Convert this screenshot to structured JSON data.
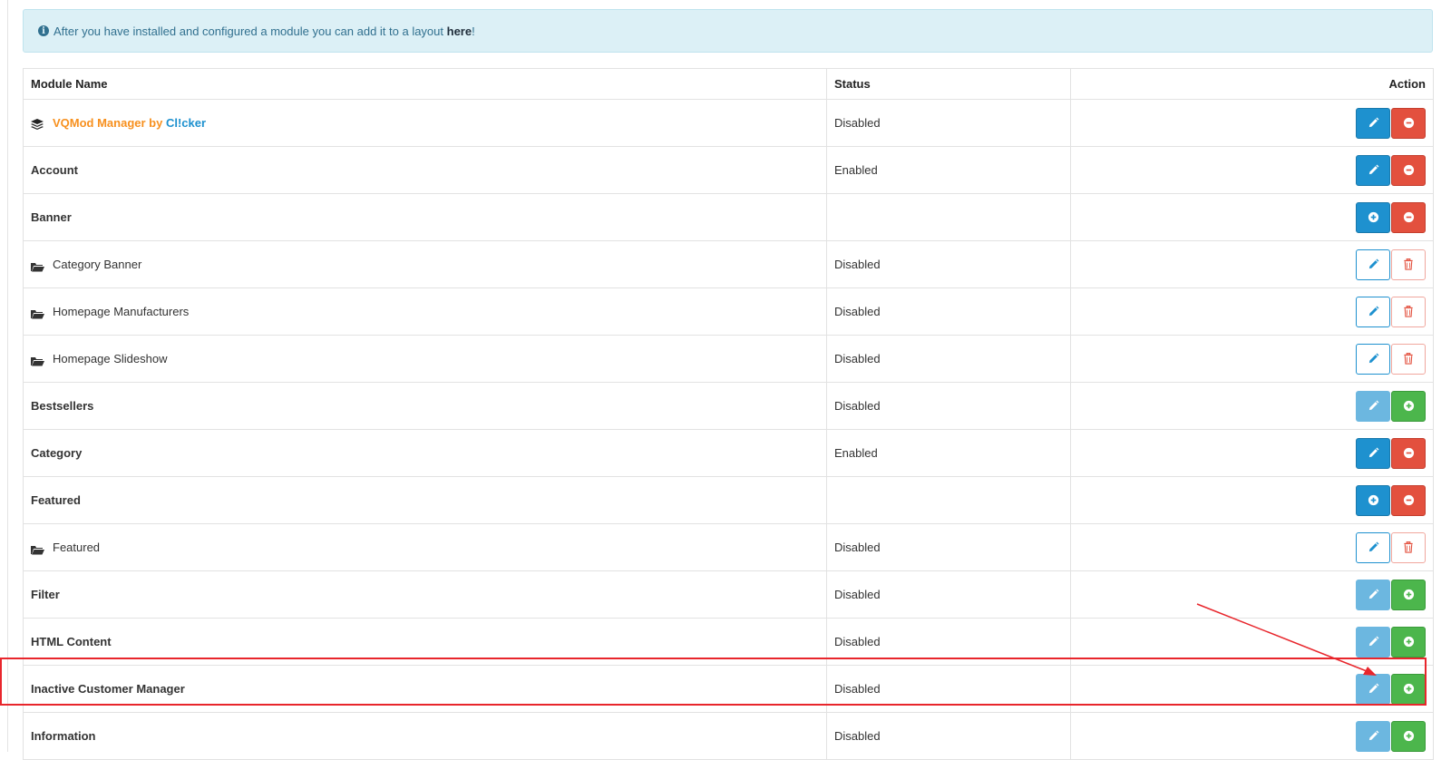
{
  "alert": {
    "text_before": "After you have installed and configured a module you can add it to a layout ",
    "link": "here",
    "text_after": "!"
  },
  "table": {
    "headers": {
      "name": "Module Name",
      "status": "Status",
      "action": "Action"
    },
    "rows": [
      {
        "name": "",
        "status": "Disabled",
        "type": "vqmod",
        "actions": [
          "edit",
          "uninstall"
        ]
      },
      {
        "name": "Account",
        "status": "Enabled",
        "type": "module",
        "actions": [
          "edit",
          "uninstall"
        ]
      },
      {
        "name": "Banner",
        "status": "",
        "type": "module",
        "actions": [
          "add",
          "uninstall"
        ]
      },
      {
        "name": "Category Banner",
        "status": "Disabled",
        "type": "child",
        "actions": [
          "edit-outline",
          "delete-outline"
        ]
      },
      {
        "name": "Homepage Manufacturers",
        "status": "Disabled",
        "type": "child",
        "actions": [
          "edit-outline",
          "delete-outline"
        ]
      },
      {
        "name": "Homepage Slideshow",
        "status": "Disabled",
        "type": "child",
        "actions": [
          "edit-outline",
          "delete-outline"
        ]
      },
      {
        "name": "Bestsellers",
        "status": "Disabled",
        "type": "module",
        "actions": [
          "edit-disabled",
          "install"
        ]
      },
      {
        "name": "Category",
        "status": "Enabled",
        "type": "module",
        "actions": [
          "edit",
          "uninstall"
        ]
      },
      {
        "name": "Featured",
        "status": "",
        "type": "module",
        "actions": [
          "add",
          "uninstall"
        ]
      },
      {
        "name": "Featured",
        "status": "Disabled",
        "type": "child",
        "actions": [
          "edit-outline",
          "delete-outline"
        ]
      },
      {
        "name": "Filter",
        "status": "Disabled",
        "type": "module",
        "actions": [
          "edit-disabled",
          "install"
        ]
      },
      {
        "name": "HTML Content",
        "status": "Disabled",
        "type": "module",
        "actions": [
          "edit-disabled",
          "install"
        ]
      },
      {
        "name": "Inactive Customer Manager",
        "status": "Disabled",
        "type": "module",
        "actions": [
          "edit-disabled",
          "install"
        ]
      },
      {
        "name": "Information",
        "status": "Disabled",
        "type": "module",
        "actions": [
          "edit-disabled",
          "install"
        ]
      }
    ]
  },
  "vqmod": {
    "part1": "VQMod Manager by ",
    "part2": "Cl!cker"
  },
  "icons": {
    "info": "info-circle-icon",
    "layers": "layers-icon",
    "folder": "folder-open-icon",
    "edit": "pencil-icon",
    "uninstall": "minus-circle-icon",
    "install": "plus-circle-icon",
    "delete": "trash-icon"
  },
  "info_glyph": "i",
  "colors": {
    "primary": "#1e91cf",
    "danger": "#e3503e",
    "success": "#4cb64c",
    "annotation": "#e8262c",
    "alert_bg": "#dcf0f6"
  }
}
